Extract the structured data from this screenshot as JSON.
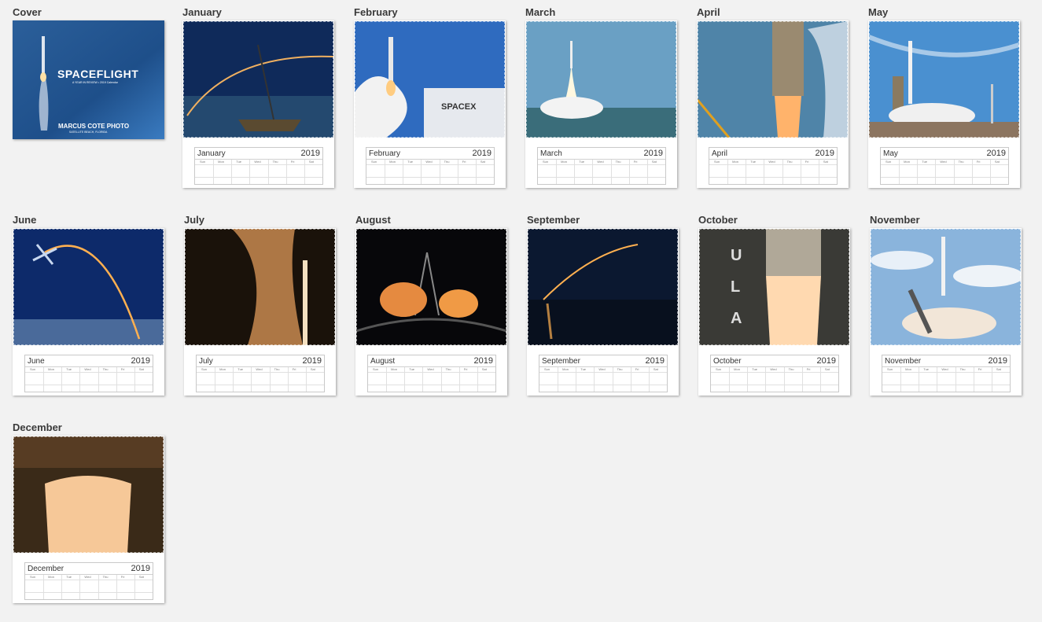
{
  "cover": {
    "label": "Cover",
    "title": "SPACEFLIGHT",
    "subtitle": "A YEAR IN REVIEW • 2019 Calendar",
    "brand": "MARCUS COTE PHOTO",
    "brand_sub": "SATELLITE BEACH, FLORIDA"
  },
  "months": [
    {
      "label": "January",
      "name": "January",
      "year": "2019",
      "photo": "rocket-trail-over-sailboat"
    },
    {
      "label": "February",
      "name": "February",
      "year": "2019",
      "photo": "rocket-launch-spacex-hangar"
    },
    {
      "label": "March",
      "name": "March",
      "year": "2019",
      "photo": "rocket-launch-smoke"
    },
    {
      "label": "April",
      "name": "April",
      "year": "2019",
      "photo": "rocket-engine-ignition"
    },
    {
      "label": "May",
      "name": "May",
      "year": "2019",
      "photo": "rocket-on-launch-pad"
    },
    {
      "label": "June",
      "name": "June",
      "year": "2019",
      "photo": "rocket-arc-twilight"
    },
    {
      "label": "July",
      "name": "July",
      "year": "2019",
      "photo": "night-launch-steam"
    },
    {
      "label": "August",
      "name": "August",
      "year": "2019",
      "photo": "fisheye-night-launch"
    },
    {
      "label": "September",
      "name": "September",
      "year": "2019",
      "photo": "launch-arc-over-water"
    },
    {
      "label": "October",
      "name": "October",
      "year": "2019",
      "photo": "ula-rocket-engines"
    },
    {
      "label": "November",
      "name": "November",
      "year": "2019",
      "photo": "rocket-launch-clouds"
    },
    {
      "label": "December",
      "name": "December",
      "year": "2019",
      "photo": "engine-plume-closeup"
    }
  ],
  "weekdays": [
    "Sun",
    "Mon",
    "Tue",
    "Wed",
    "Thu",
    "Fri",
    "Sat"
  ],
  "colors": {
    "background": "#f2f2f2",
    "label": "#3a3a3a",
    "page": "#ffffff"
  }
}
